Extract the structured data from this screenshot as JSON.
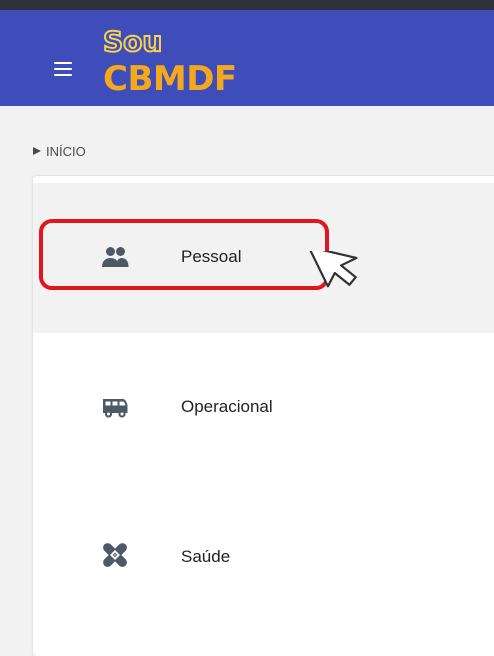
{
  "app": {
    "logo_line1": "Sou",
    "logo_line2": "CBMDF"
  },
  "breadcrumb": {
    "label": "INÍCIO"
  },
  "menu": {
    "items": [
      {
        "label": "Pessoal",
        "icon": "people-icon",
        "highlighted": true
      },
      {
        "label": "Operacional",
        "icon": "truck-icon",
        "highlighted": false
      },
      {
        "label": "Saúde",
        "icon": "bandage-icon",
        "highlighted": false
      }
    ]
  },
  "colors": {
    "appbar": "#3f4dbb",
    "logo_orange": "#f4a81c",
    "highlight_box": "#e0151e",
    "icon": "#4d5a66"
  }
}
